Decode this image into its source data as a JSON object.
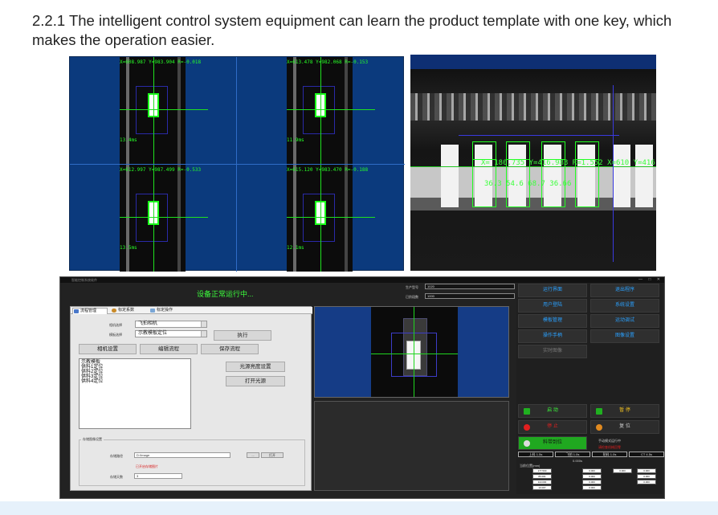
{
  "caption": "2.2.1 The intelligent control system equipment can learn the product template with one key, which makes the operation easier.",
  "panel_a": {
    "cameras": [
      {
        "coords": "X=608.987 Y=983.904 R=-0.018",
        "zoom": "13.4ms"
      },
      {
        "coords": "X=613.478 Y=982.068 R=-0.153",
        "zoom": "11.9ms"
      },
      {
        "coords": "X=612.997 Y=987.499 R=-0.533",
        "zoom": "13.5ms"
      },
      {
        "coords": "X=615.120 Y=983.470 R=-0.188",
        "zoom": "12.1ms"
      }
    ]
  },
  "panel_b": {
    "readout": "X= 180.735 Y=416.983 R=1.552 X=610 Y=416",
    "readout2": "36.3   54.6   68.7   36.66"
  },
  "panel_c": {
    "window_title": "智能控制系统软件",
    "status": "设备正常运行中...",
    "right_labels": {
      "product_model": "生产型号",
      "current_count": "已阶段数"
    },
    "right_values": {
      "product_model": "1020",
      "current_count": "1000"
    },
    "tabs": [
      "流程管理",
      "标定系数",
      "标定操作"
    ],
    "camera_label": "相机选择",
    "template_label": "模板选择",
    "camera_value": "飞拍相机",
    "template_value": "示教模板定位",
    "buttons": {
      "execute": "执行",
      "camera_settings": "相机设置",
      "edit_flow": "编辑流程",
      "save_flow": "保存流程",
      "light_settings": "光源亮度设置",
      "open_light": "打开光源"
    },
    "list_items": [
      "示教模板",
      "供料1定位",
      "供料2定位",
      "供料3定位",
      "供料4定位"
    ],
    "group": {
      "title": "存储图像设置",
      "path_label": "存储路径",
      "path_value": "D:\\Image",
      "path_btn1": "...",
      "path_btn2": "打开",
      "red_note": "已开启存储图片",
      "days_label": "存储天数",
      "days_value": "3"
    },
    "menu": [
      "运行界面",
      "退出程序",
      "用户登陆",
      "系统设置",
      "模板管理",
      "运动调试",
      "操作手柄",
      "图像设置",
      "实时图像"
    ],
    "controls": {
      "start": "启 动",
      "pause": "暂 停",
      "stop": "停 止",
      "reset": "复 位",
      "feed": "料带到位",
      "hint": "手动模式运行中",
      "alarm": "请检查机械回零"
    },
    "stats": [
      {
        "label": "上料 1.5s",
        "value": ""
      },
      {
        "label": "飞拍 1.0s",
        "value": ""
      },
      {
        "label": "贴料 1.0s",
        "value": ""
      },
      {
        "label": "CT 4.5s",
        "value": ""
      }
    ],
    "ct_value": "0.000s",
    "position_title": "当前位置(mm)",
    "grid_a": [
      "X",
      "Y",
      "Z",
      "R1",
      "R2"
    ],
    "grid_a_vals": [
      "177.500",
      "86.001",
      "110.000",
      "10.007",
      "0.000"
    ],
    "grid_b_vals": [
      "0.000",
      "0.000",
      "0.000",
      "0.000",
      "0.000"
    ]
  },
  "colors": {
    "status_green": "#3cff3c",
    "menu_blue": "#2aa1ff",
    "stop_red": "#e21f1f",
    "feed_green": "#20a820",
    "overlay_green": "#1fe11f",
    "image_blue": "#0b3a7d"
  }
}
